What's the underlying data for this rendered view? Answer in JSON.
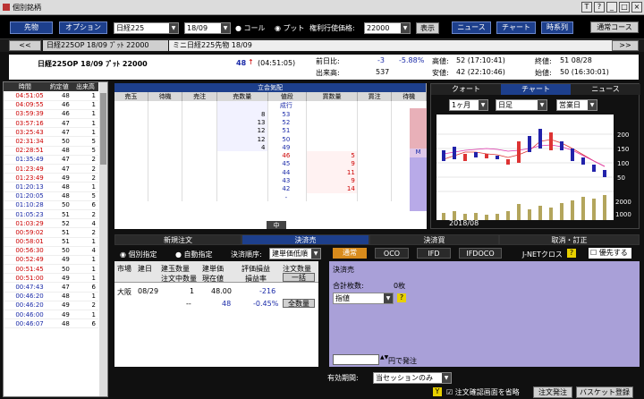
{
  "window": {
    "title": "個別銘柄",
    "btns": [
      "T",
      "?",
      "_",
      "□",
      "×"
    ]
  },
  "toolbar": {
    "sakimono": "先物",
    "option": "オプション",
    "symbol": "日経225",
    "month": "18/09",
    "call": "コール",
    "put": "プット",
    "strike_label": "権利行使価格:",
    "strike": "22000",
    "show": "表示",
    "news": "ニュース",
    "chart": "チャート",
    "jikei": "時系列",
    "course": "通常コース"
  },
  "tabs": {
    "prev": "<<",
    "t1": "日経225OP 18/09 ﾌﾟｯﾄ 22000",
    "t2": "ミニ日経225先物 18/09",
    "next": ">>"
  },
  "info": {
    "name": "日経225OP 18/09 ﾌﾟｯﾄ 22000",
    "price": "48",
    "arrow": "↑",
    "time": "(04:51:05)",
    "prev_label": "前日比:",
    "prev_chg": "-3",
    "prev_pct": "-5.88%",
    "vol_label": "出来高:",
    "vol": "537",
    "open_label": "始値:",
    "open": "52 (17:10:41)",
    "high_label": "高値:",
    "high": "52 (17:10:41)",
    "low_label": "安値:",
    "low": "42 (22:10:46)",
    "close_label": "終値:",
    "close": "51 08/28",
    "settle_label": "始値:",
    "settle": "50 (16:30:01)"
  },
  "tick": {
    "headers": [
      "時間",
      "約定値",
      "出来高"
    ],
    "rows": [
      [
        "04:51:05",
        "48",
        "1"
      ],
      [
        "04:09:55",
        "46",
        "1"
      ],
      [
        "03:59:39",
        "46",
        "1"
      ],
      [
        "03:57:16",
        "47",
        "1"
      ],
      [
        "03:25:43",
        "47",
        "1"
      ],
      [
        "02:31:34",
        "50",
        "5"
      ],
      [
        "02:28:51",
        "48",
        "5"
      ],
      [
        "01:35:49",
        "47",
        "2"
      ],
      [
        "01:23:49",
        "47",
        "2"
      ],
      [
        "01:23:49",
        "49",
        "2"
      ],
      [
        "01:20:13",
        "48",
        "1"
      ],
      [
        "01:20:05",
        "48",
        "5"
      ],
      [
        "01:10:28",
        "50",
        "6"
      ],
      [
        "01:05:23",
        "51",
        "2"
      ],
      [
        "01:03:29",
        "52",
        "4"
      ],
      [
        "00:59:02",
        "51",
        "2"
      ],
      [
        "00:58:01",
        "51",
        "1"
      ],
      [
        "00:56:30",
        "50",
        "4"
      ],
      [
        "00:52:49",
        "49",
        "1"
      ],
      [
        "00:51:45",
        "50",
        "1"
      ],
      [
        "00:51:00",
        "49",
        "1"
      ],
      [
        "00:47:43",
        "47",
        "6"
      ],
      [
        "00:46:20",
        "48",
        "1"
      ],
      [
        "00:46:20",
        "49",
        "2"
      ],
      [
        "00:46:00",
        "49",
        "1"
      ],
      [
        "00:46:07",
        "48",
        "6"
      ]
    ]
  },
  "board": {
    "caption": "立会気配",
    "headers": [
      "売玉",
      "待機",
      "売注",
      "売数量",
      "値段",
      "買数量",
      "買注",
      "待機"
    ],
    "rows": [
      [
        "",
        "",
        "",
        "",
        "成行",
        "",
        ""
      ],
      [
        "",
        "",
        "",
        "8",
        "53",
        "",
        ""
      ],
      [
        "",
        "",
        "",
        "13",
        "52",
        "",
        ""
      ],
      [
        "",
        "",
        "",
        "12",
        "51",
        "",
        ""
      ],
      [
        "",
        "",
        "",
        "12",
        "50",
        "",
        ""
      ],
      [
        "",
        "",
        "",
        "4",
        "49",
        "",
        ""
      ],
      [
        "",
        "",
        "",
        "",
        "46",
        "5",
        ""
      ],
      [
        "",
        "",
        "",
        "",
        "45",
        "9",
        ""
      ],
      [
        "",
        "",
        "",
        "",
        "44",
        "11",
        ""
      ],
      [
        "",
        "",
        "",
        "",
        "43",
        "9",
        ""
      ],
      [
        "",
        "",
        "",
        "",
        "42",
        "14",
        ""
      ],
      [
        "",
        "",
        "",
        "",
        "-",
        "",
        ""
      ]
    ],
    "center": "中"
  },
  "chartpanel": {
    "tab1": "クォート",
    "tab2": "チャート",
    "tab3": "ニュース",
    "period": "1ヶ月",
    "type": "日足",
    "biz": "営業日",
    "ylabels": [
      "200",
      "150",
      "100",
      "50"
    ],
    "vlabels": [
      "2000",
      "1000"
    ],
    "xlabel": "2018/08"
  },
  "order_tabs": [
    "新規注文",
    "決済売",
    "決済買",
    "取消・訂正"
  ],
  "settle": {
    "individual": "個別指定",
    "auto": "自動指定",
    "order_label": "決済順序:",
    "order": "建単価低順",
    "normal": "通常",
    "oco": "OCO",
    "ifd": "IFD",
    "ifdoco": "IFDOCO",
    "jnet": "J-NETクロス",
    "jnet_q": "?",
    "priority": "優先する"
  },
  "positions": {
    "headers": [
      "市場",
      "建日",
      "建玉数量",
      "建単価",
      "評価損益",
      "注文数量"
    ],
    "sub": [
      "",
      "",
      "注文中数量",
      "現在値",
      "損益率",
      ""
    ],
    "ikkatsu": "一括",
    "zen": "全数量",
    "market": "大阪",
    "date": "08/29",
    "qty": "1",
    "cost": "48.00",
    "pl": "-216",
    "pending": "--",
    "now": "48",
    "rate": "-0.45%"
  },
  "right": {
    "title": "決済売",
    "total_label": "合計枚数:",
    "total": "0枚",
    "cond": "指値",
    "cond_q": "?",
    "hachu": "円で発注"
  },
  "bottom": {
    "valid_label": "有効期間:",
    "valid": "当セッションのみ",
    "skip": "注文確認画面を省略",
    "send": "注文発注",
    "basket": "バスケット登録",
    "y": "Y"
  }
}
